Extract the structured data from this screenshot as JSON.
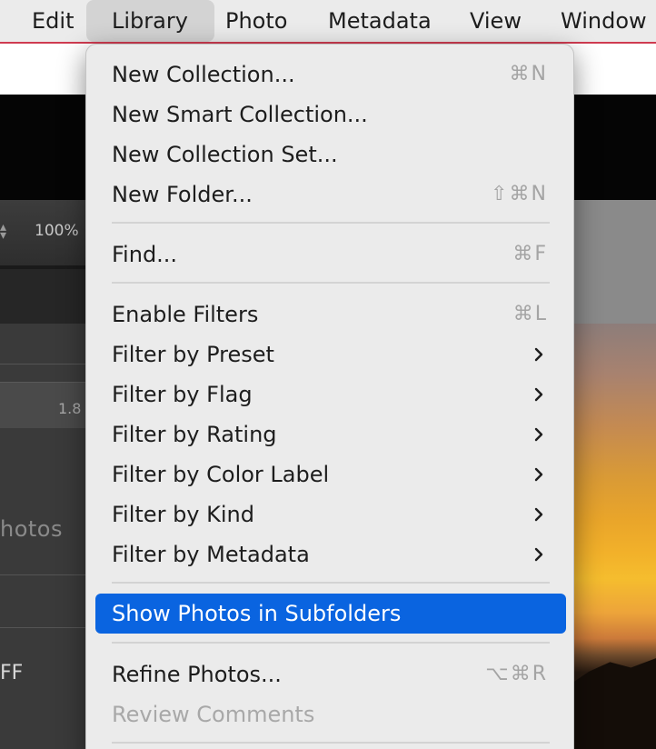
{
  "menubar": {
    "items": [
      {
        "label": "Edit"
      },
      {
        "label": "Library"
      },
      {
        "label": "Photo"
      },
      {
        "label": "Metadata"
      },
      {
        "label": "View"
      },
      {
        "label": "Window"
      }
    ],
    "active": "Library"
  },
  "background": {
    "zoom_level": "100%",
    "aperture_value": "1.8 /",
    "photos_label": "hotos",
    "off_label": "FF"
  },
  "menu": {
    "new_collection": {
      "label": "New Collection...",
      "shortcut": "⌘N"
    },
    "new_smart_collection": {
      "label": "New Smart Collection..."
    },
    "new_collection_set": {
      "label": "New Collection Set..."
    },
    "new_folder": {
      "label": "New Folder...",
      "shortcut": "⇧⌘N"
    },
    "find": {
      "label": "Find...",
      "shortcut": "⌘F"
    },
    "enable_filters": {
      "label": "Enable Filters",
      "shortcut": "⌘L"
    },
    "filter_by_preset": {
      "label": "Filter by Preset"
    },
    "filter_by_flag": {
      "label": "Filter by Flag"
    },
    "filter_by_rating": {
      "label": "Filter by Rating"
    },
    "filter_by_color_label": {
      "label": "Filter by Color Label"
    },
    "filter_by_kind": {
      "label": "Filter by Kind"
    },
    "filter_by_metadata": {
      "label": "Filter by Metadata"
    },
    "show_photos_in_subfolders": {
      "label": "Show Photos in Subfolders"
    },
    "refine_photos": {
      "label": "Refine Photos...",
      "shortcut": "⌥⌘R"
    },
    "review_comments": {
      "label": "Review Comments"
    }
  },
  "colors": {
    "highlight": "#0a64e0",
    "menubar_underline": "#cf3b50"
  }
}
